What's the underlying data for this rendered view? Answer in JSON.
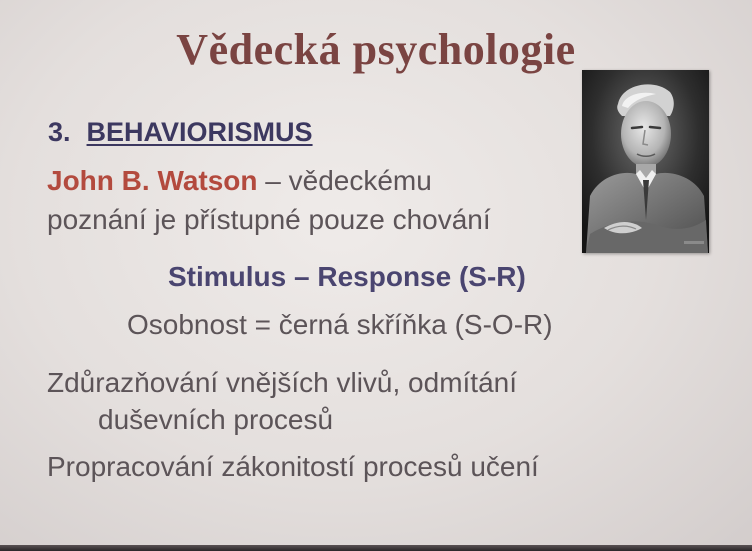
{
  "slide": {
    "title": "Vědecká psychologie",
    "heading": {
      "number": "3.",
      "label": "BEHAVIORISMUS"
    },
    "watson_name": "John B. Watson",
    "watson_rest": " – vědeckému",
    "line2": "poznání je přístupné pouze chování",
    "stimulus_response": "Stimulus – Response (S-R)",
    "personality": "Osobnost = černá skříňka (S-O-R)",
    "bullet1_line1": "Zdůrazňování vnějších vlivů, odmítání",
    "bullet1_line2": "duševních procesů",
    "bullet2": "Propracování zákonitostí procesů učení"
  },
  "colors": {
    "title": "#7a4442",
    "heading": "#3c3860",
    "name_accent": "#b34a3e",
    "body_text": "#5c5458",
    "background": "#e4dfdd"
  },
  "portrait": {
    "icon": "portrait-photo"
  }
}
